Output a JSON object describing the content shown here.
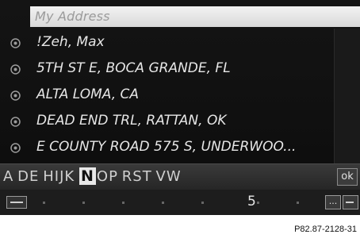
{
  "header": {
    "title": "My Address"
  },
  "list": {
    "items": [
      {
        "label": "!Zeh, Max"
      },
      {
        "label": "5TH ST E, BOCA GRANDE, FL"
      },
      {
        "label": "ALTA LOMA, CA"
      },
      {
        "label": "DEAD END TRL, RATTAN, OK"
      },
      {
        "label": "E COUNTY ROAD 575 S, UNDERWOO..."
      }
    ]
  },
  "speller": {
    "segments": [
      {
        "text": "A",
        "style": "normal"
      },
      {
        "text": " ",
        "style": "dim"
      },
      {
        "text": "DE",
        "style": "normal"
      },
      {
        "text": " ",
        "style": "dim"
      },
      {
        "text": "HIJK",
        "style": "normal"
      },
      {
        "text": " ",
        "style": "dim"
      },
      {
        "text": "N",
        "style": "selected"
      },
      {
        "text": "OP",
        "style": "normal"
      },
      {
        "text": " ",
        "style": "dim"
      },
      {
        "text": "RST",
        "style": "normal"
      },
      {
        "text": " ",
        "style": "dim"
      },
      {
        "text": "VW",
        "style": "normal"
      }
    ],
    "ok_label": "ok"
  },
  "bottom_bar": {
    "number": "5",
    "more_label": "..."
  },
  "caption": "P82.87-2128-31",
  "colors": {
    "screen_bg": "#111111",
    "text": "#e6e6e6",
    "header_bg": "#e4e4e4",
    "header_text": "#9a9a9a"
  },
  "icons": {
    "bullet": "dot-icon",
    "minus": "minus-icon",
    "back": "back-icon"
  }
}
